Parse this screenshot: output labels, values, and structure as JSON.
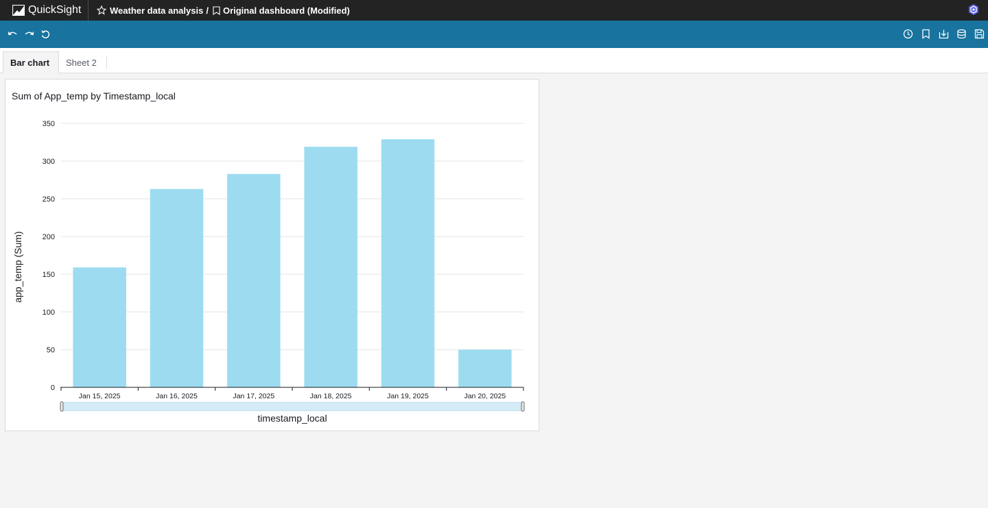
{
  "app": {
    "name": "QuickSight"
  },
  "breadcrumb": {
    "analysis": "Weather data analysis",
    "separator": "/",
    "dashboard": "Original dashboard (Modified)"
  },
  "tabs": [
    {
      "label": "Bar chart",
      "active": true
    },
    {
      "label": "Sheet 2",
      "active": false
    }
  ],
  "colors": {
    "topbar": "#232323",
    "toolbar": "#18739e",
    "bar": "#9ddcf0",
    "scrollbar": "#d5ecf8"
  },
  "icons": {
    "toolbar_left": [
      "undo-icon",
      "redo-icon",
      "reset-icon"
    ],
    "toolbar_right": [
      "history-icon",
      "bookmark-icon",
      "export-icon",
      "data-icon",
      "save-icon"
    ]
  },
  "chart_data": {
    "type": "bar",
    "title": "Sum of App_temp by Timestamp_local",
    "xlabel": "timestamp_local",
    "ylabel": "app_temp (Sum)",
    "categories": [
      "Jan 15, 2025",
      "Jan 16, 2025",
      "Jan 17, 2025",
      "Jan 18, 2025",
      "Jan 19, 2025",
      "Jan 20, 2025"
    ],
    "values": [
      159,
      263,
      283,
      319,
      329,
      50
    ],
    "ylim": [
      0,
      350
    ],
    "yticks": [
      0,
      50,
      100,
      150,
      200,
      250,
      300,
      350
    ],
    "grid": true
  }
}
